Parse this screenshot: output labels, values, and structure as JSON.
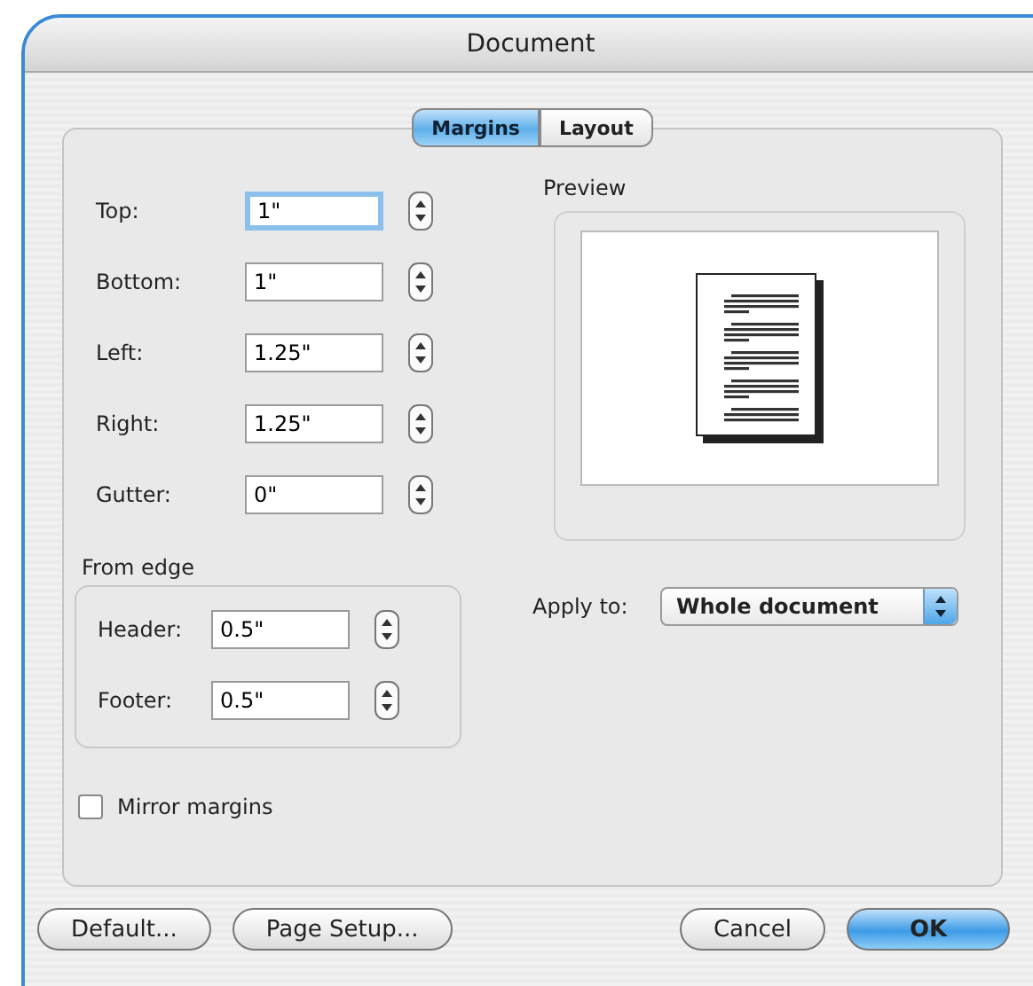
{
  "window": {
    "title": "Document"
  },
  "tabs": [
    {
      "label": "Margins",
      "selected": true
    },
    {
      "label": "Layout",
      "selected": false
    }
  ],
  "margins": [
    {
      "label": "Top:",
      "value": "1\"",
      "focused": true
    },
    {
      "label": "Bottom:",
      "value": "1\"",
      "focused": false
    },
    {
      "label": "Left:",
      "value": "1.25\"",
      "focused": false
    },
    {
      "label": "Right:",
      "value": "1.25\"",
      "focused": false
    },
    {
      "label": "Gutter:",
      "value": "0\"",
      "focused": false
    }
  ],
  "from_edge": {
    "title": "From edge",
    "fields": [
      {
        "label": "Header:",
        "value": "0.5\""
      },
      {
        "label": "Footer:",
        "value": "0.5\""
      }
    ]
  },
  "mirror_margins": {
    "label": "Mirror margins",
    "checked": false
  },
  "preview": {
    "title": "Preview"
  },
  "apply_to": {
    "label": "Apply to:",
    "value": "Whole document"
  },
  "buttons": [
    {
      "label": "Default...",
      "kind": "normal"
    },
    {
      "label": "Page Setup...",
      "kind": "normal"
    },
    {
      "label": "Cancel",
      "kind": "normal"
    },
    {
      "label": "OK",
      "kind": "default"
    }
  ]
}
